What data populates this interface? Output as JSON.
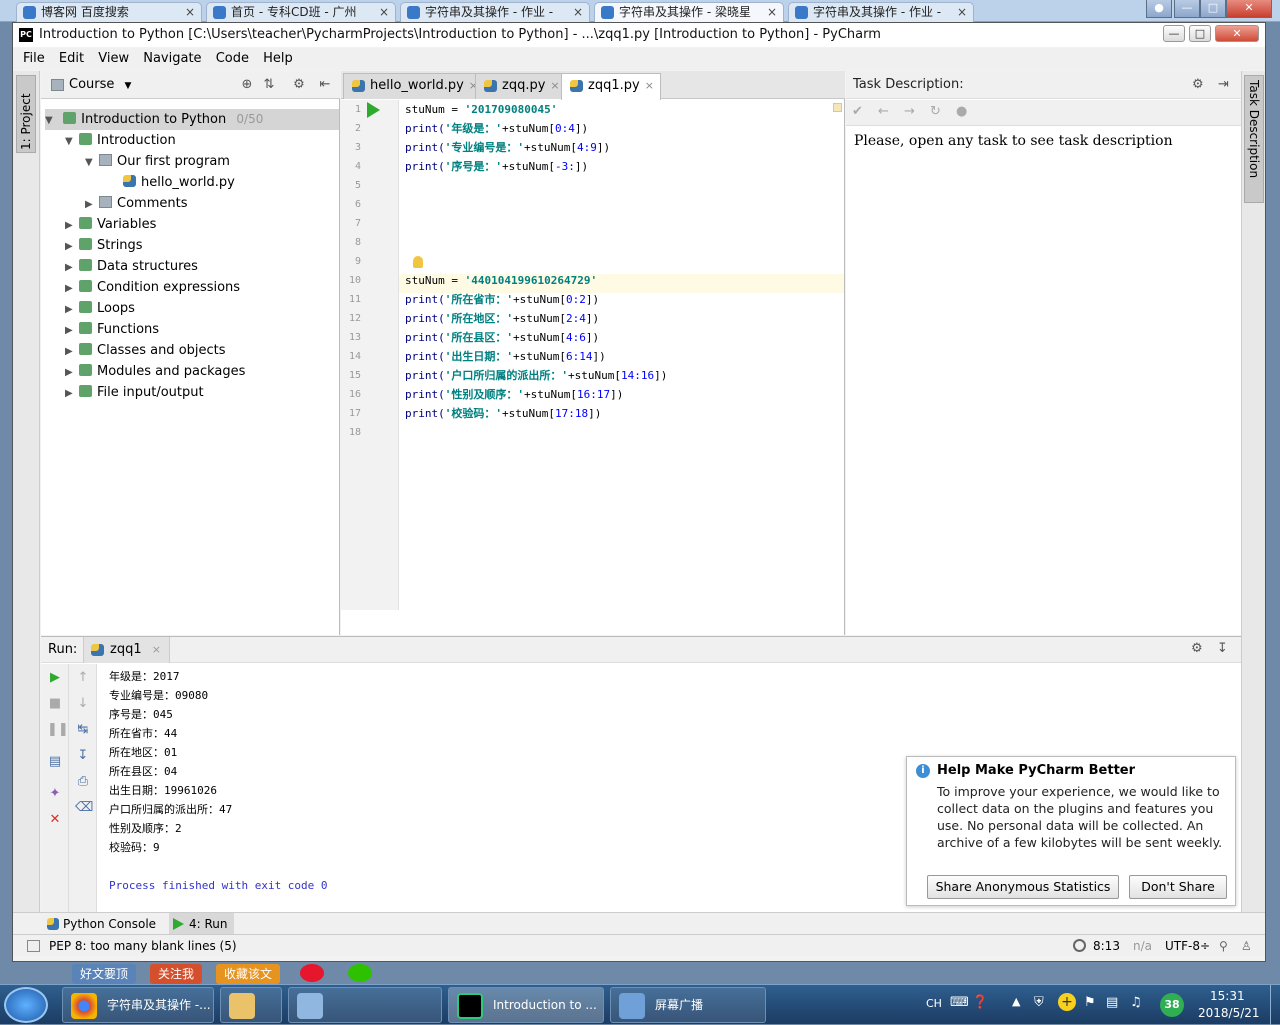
{
  "browser": {
    "tabs": [
      {
        "label": "博客网 百度搜索"
      },
      {
        "label": "首页 - 专科CD班 - 广州"
      },
      {
        "label": "字符串及其操作 - 作业 -"
      },
      {
        "label": "字符串及其操作 - 梁晓星"
      },
      {
        "label": "字符串及其操作 - 作业 -"
      }
    ],
    "close_glyph": "×"
  },
  "window": {
    "title": "Introduction to Python [C:\\Users\\teacher\\PycharmProjects\\Introduction to Python] - ...\\zqq1.py [Introduction to Python] - PyCharm",
    "app_icon_text": "PC"
  },
  "menu": [
    "File",
    "Edit",
    "View",
    "Navigate",
    "Code",
    "Help"
  ],
  "left_tool_tab": "1: Project",
  "right_tool_tab": "Task Description",
  "project": {
    "view_label": "Course",
    "root": {
      "label": "Introduction to Python",
      "progress": "0/50"
    },
    "items": [
      {
        "label": "Introduction",
        "expanded": true
      },
      {
        "label": "Our first program",
        "expanded": true
      },
      {
        "label": "hello_world.py"
      },
      {
        "label": "Comments"
      },
      {
        "label": "Variables"
      },
      {
        "label": "Strings"
      },
      {
        "label": "Data structures"
      },
      {
        "label": "Condition expressions"
      },
      {
        "label": "Loops"
      },
      {
        "label": "Functions"
      },
      {
        "label": "Classes and objects"
      },
      {
        "label": "Modules and packages"
      },
      {
        "label": "File input/output"
      }
    ]
  },
  "editor": {
    "tabs": [
      {
        "label": "hello_world.py"
      },
      {
        "label": "zqq.py"
      },
      {
        "label": "zqq1.py",
        "active": true
      }
    ],
    "line_numbers": [
      "1",
      "2",
      "3",
      "4",
      "5",
      "6",
      "7",
      "8",
      "9",
      "10",
      "11",
      "12",
      "13",
      "14",
      "15",
      "16",
      "17",
      "18"
    ],
    "lines": [
      {
        "line": 1,
        "pre": "stuNum = ",
        "str": "'201709080045'",
        "post": ""
      },
      {
        "line": 2,
        "pre": "print(",
        "str": "'年级是：'",
        "post": "+stuNum[",
        "num": "0:4",
        "end": "])"
      },
      {
        "line": 3,
        "pre": "print(",
        "str": "'专业编号是：'",
        "post": "+stuNum[",
        "num": "4:9",
        "end": "])"
      },
      {
        "line": 4,
        "pre": "print(",
        "str": "'序号是：'",
        "post": "+stuNum[",
        "num": "-3:",
        "end": "])"
      },
      {
        "line": 10,
        "pre": "stuNum = ",
        "str": "'440104199610264729'",
        "post": ""
      },
      {
        "line": 11,
        "pre": "print(",
        "str": "'所在省市：'",
        "post": "+stuNum[",
        "num": "0:2",
        "end": "])"
      },
      {
        "line": 12,
        "pre": "print(",
        "str": "'所在地区：'",
        "post": "+stuNum[",
        "num": "2:4",
        "end": "])"
      },
      {
        "line": 13,
        "pre": "print(",
        "str": "'所在县区：'",
        "post": "+stuNum[",
        "num": "4:6",
        "end": "])"
      },
      {
        "line": 14,
        "pre": "print(",
        "str": "'出生日期：'",
        "post": "+stuNum[",
        "num": "6:14",
        "end": "])"
      },
      {
        "line": 15,
        "pre": "print(",
        "str": "'户口所归属的派出所：'",
        "post": "+stuNum[",
        "num": "14:16",
        "end": "])"
      },
      {
        "line": 16,
        "pre": "print(",
        "str": "'性别及顺序：'",
        "post": "+stuNum[",
        "num": "16:17",
        "end": "])"
      },
      {
        "line": 17,
        "pre": "print(",
        "str": "'校验码：'",
        "post": "+stuNum[",
        "num": "17:18",
        "end": "])"
      }
    ],
    "current_line": 10
  },
  "task": {
    "header": "Task Description:",
    "body": "Please, open any task to see task description"
  },
  "run": {
    "header": "Run:",
    "tab": "zqq1",
    "output": [
      "年级是：2017",
      "专业编号是：09080",
      "序号是：045",
      "所在省市：44",
      "所在地区：01",
      "所在县区：04",
      "出生日期：19961026",
      "户口所归属的派出所：47",
      "性别及顺序：2",
      "校验码：9"
    ],
    "finished": "Process finished with exit code 0"
  },
  "bottom_tools": [
    {
      "label": "Python Console"
    },
    {
      "label": "4: Run"
    }
  ],
  "status": {
    "message": "PEP 8: too many blank lines (5)",
    "position": "8:13",
    "na": "n/a",
    "encoding": "UTF-8÷"
  },
  "balloon": {
    "title": "Help Make PyCharm Better",
    "body": "To improve your experience, we would like to collect data on the plugins and features you use. No personal data will be collected. An archive of a few kilobytes will be sent weekly.",
    "share_label": "Share Anonymous Statistics",
    "dont_share_label": "Don't Share"
  },
  "weibo": [
    "好文要顶",
    "关注我",
    "收藏该文"
  ],
  "taskbar": {
    "items": [
      {
        "label": "字符串及其操作 -..."
      },
      {
        "label": ""
      },
      {
        "label": ""
      },
      {
        "label": "Introduction to ..."
      },
      {
        "label": "屏幕广播"
      }
    ],
    "lang": "CH",
    "badge": "38",
    "time": "15:31",
    "date": "2018/5/21"
  },
  "colors": {
    "accent": "#3c8fd5",
    "string": "#008080",
    "keyword": "#000080",
    "number": "#0000ff",
    "run_green": "#2eaa2e",
    "stop_red": "#d9302c"
  }
}
